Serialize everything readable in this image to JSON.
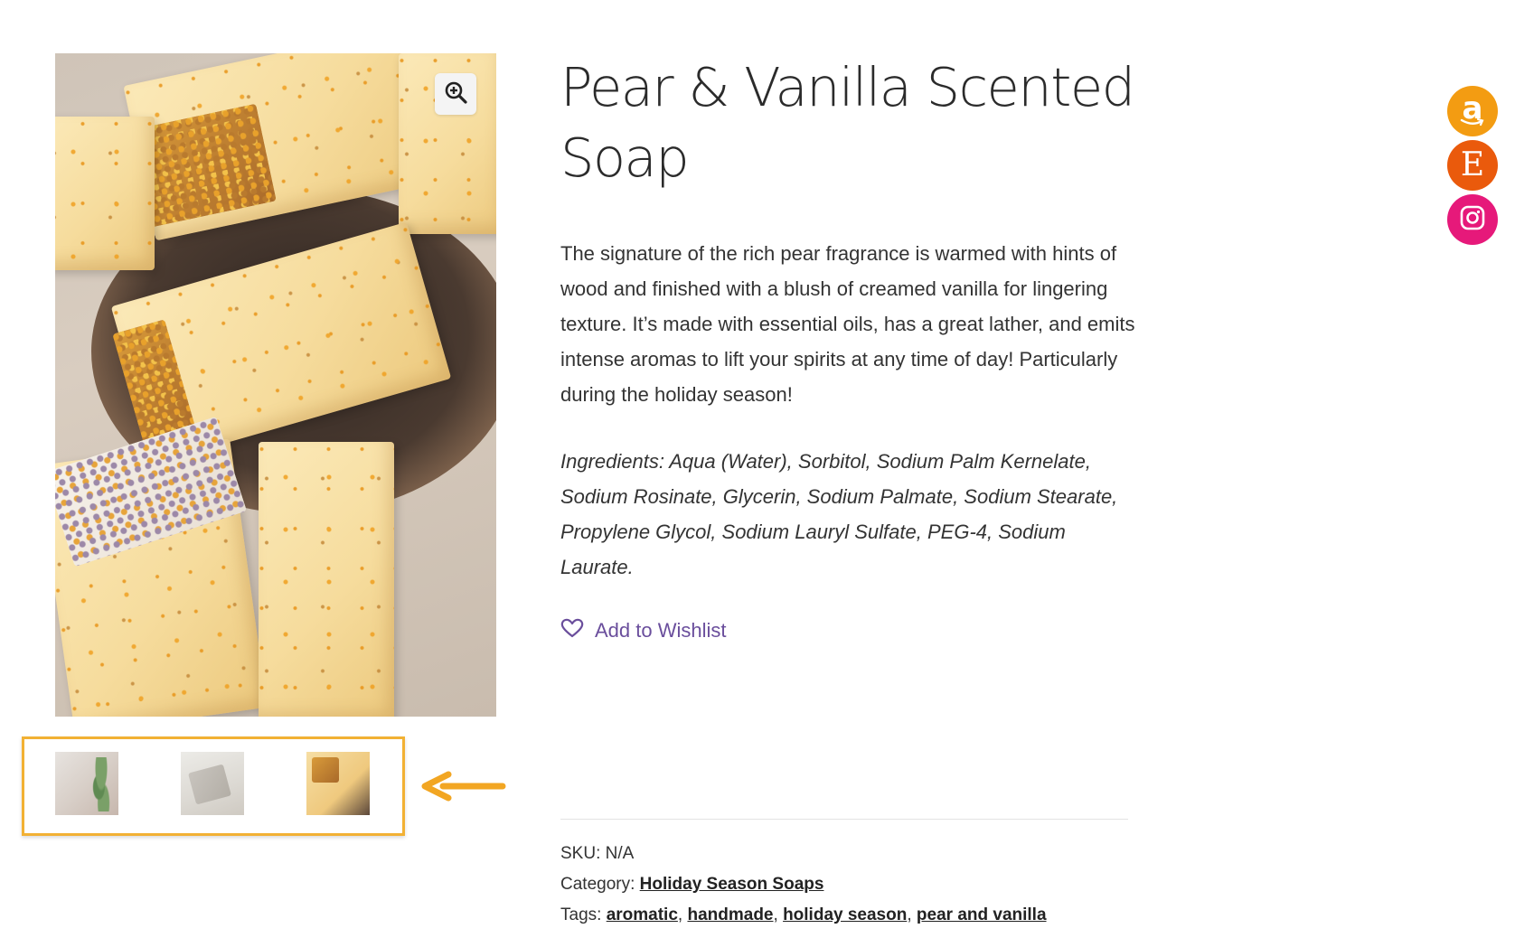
{
  "product": {
    "title": "Pear & Vanilla Scented Soap",
    "description": "The signature of the rich pear fragrance is warmed with hints of wood and finished with a blush of creamed vanilla for lingering texture. It’s made with essential oils, has a great lather, and emits intense aromas to lift your spirits at any time of day! Particularly during the holiday season!",
    "ingredients": "Ingredients: Aqua (Water), Sorbitol, Sodium Palm Kernelate, Sodium Rosinate, Glycerin, Sodium Palmate, Sodium Stearate, Propylene Glycol, Sodium Lauryl Sulfate, PEG-4, Sodium Laurate.",
    "wishlist_label": "Add to Wishlist"
  },
  "gallery": {
    "zoom_icon": "zoom-in-icon",
    "thumbnails": [
      {
        "name": "thumbnail-soap-with-leaves"
      },
      {
        "name": "thumbnail-grey-soap"
      },
      {
        "name": "thumbnail-pear-vanilla-soap"
      }
    ],
    "highlight_color": "#f2b134"
  },
  "meta": {
    "sku_label": "SKU:",
    "sku_value": "N/A",
    "category_label": "Category:",
    "category_value": "Holiday Season Soaps",
    "tags_label": "Tags:",
    "tags": [
      "aromatic",
      "handmade",
      "holiday season",
      "pear and vanilla"
    ]
  },
  "social": {
    "amazon_glyph": "a",
    "etsy_glyph": "E",
    "amazon_color": "#f39c12",
    "etsy_color": "#ea5a0c",
    "instagram_color": "#e6197a"
  },
  "colors": {
    "wishlist": "#6a4e9c",
    "arrow": "#f2a623"
  }
}
